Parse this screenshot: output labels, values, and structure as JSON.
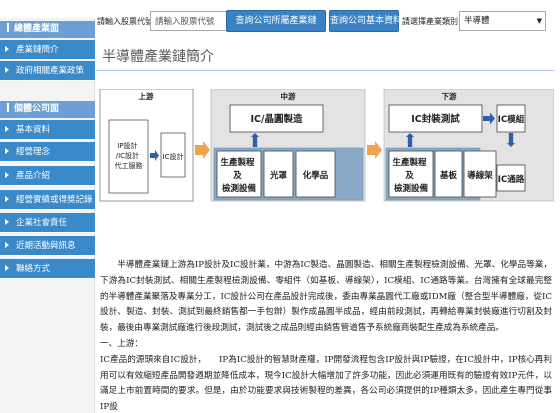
{
  "search": {
    "stock_label": "請輸入股票代號:",
    "stock_placeholder": "請輸入股票代號",
    "industry_button": "查詢公司所屬產業鏈",
    "company_button": "查詢公司基本資料",
    "category_label": "請選擇產業類別:",
    "category_value": "半導體"
  },
  "sidebar": {
    "section1_title": "總體產業面",
    "section1_items": [
      {
        "label": "產業鏈簡介"
      },
      {
        "label": "政府相關產業政策"
      }
    ],
    "section2_title": "個體公司面",
    "section2_items": [
      {
        "label": "基本資料"
      },
      {
        "label": "經營理念"
      },
      {
        "label": "產品介紹"
      },
      {
        "label": "經營實績或得獎記錄"
      },
      {
        "label": "企業社會責任"
      },
      {
        "label": "近期活動與訊息"
      },
      {
        "label": "聯絡方式"
      }
    ]
  },
  "main": {
    "title": "半導體產業鏈簡介",
    "diagram": {
      "upstream_label": "上游",
      "midstream_label": "中游",
      "downstream_label": "下游",
      "ip_box": "IP設計\n/IC設計\n代工服務",
      "ic_design": "IC設計",
      "ic_wafer": "IC/晶圓製造",
      "ic_packaging": "IC封裝測試",
      "ic_module": "IC模組",
      "ic_channel": "IC通路",
      "mid_boxes": [
        "生產製程\n及\n檢測設備",
        "光罩",
        "化學品"
      ],
      "down_boxes": [
        "生產製程\n及\n檢測設備",
        "基板",
        "導線架"
      ]
    },
    "paragraph1": "半導體產業鏈上游為IP設計及IC設計業，中游為IC製造、晶圓製造、相關生產製程檢測設備、光罩、化學品等業，下游為IC封裝測試、相關生產製程檢測設備、零組件（如基板、導線架），IC模組、IC通路等業。台灣擁有全球最完整的半導體產業聚落及專業分工，IC設計公司在產品設計完成後，委由專業晶圓代工廠或IDM廠（整合型半導體廠，從IC設計、製造、封裝、測試到最終銷售都一手包辦）製作成晶圓半成品，經由前段測試，再轉給專業封裝廠進行切割及封裝，最後由專業測試廠進行後段測試，測試後之成品則經由銷售管道售予系統廠商裝配生產成為系統產品。",
    "section_heading": "一、上游：",
    "paragraph2": "IC產品的源頭來自IC設計，　　IP為IC設計的智慧財產權，IP開發流程包含IP設計與IP驗證，在IC設計中，IP核心再利用可以有效縮短產品開發週期並降低成本，現今IC設計大幅增加了許多功能，因此必須運用既有的驗證有效IP元件，以滿足上市前置時間的要求。但是，由於功能要求與技術製程的差異，各公司必須提供的IP種類太多，因此產生專門從事IP設"
  }
}
